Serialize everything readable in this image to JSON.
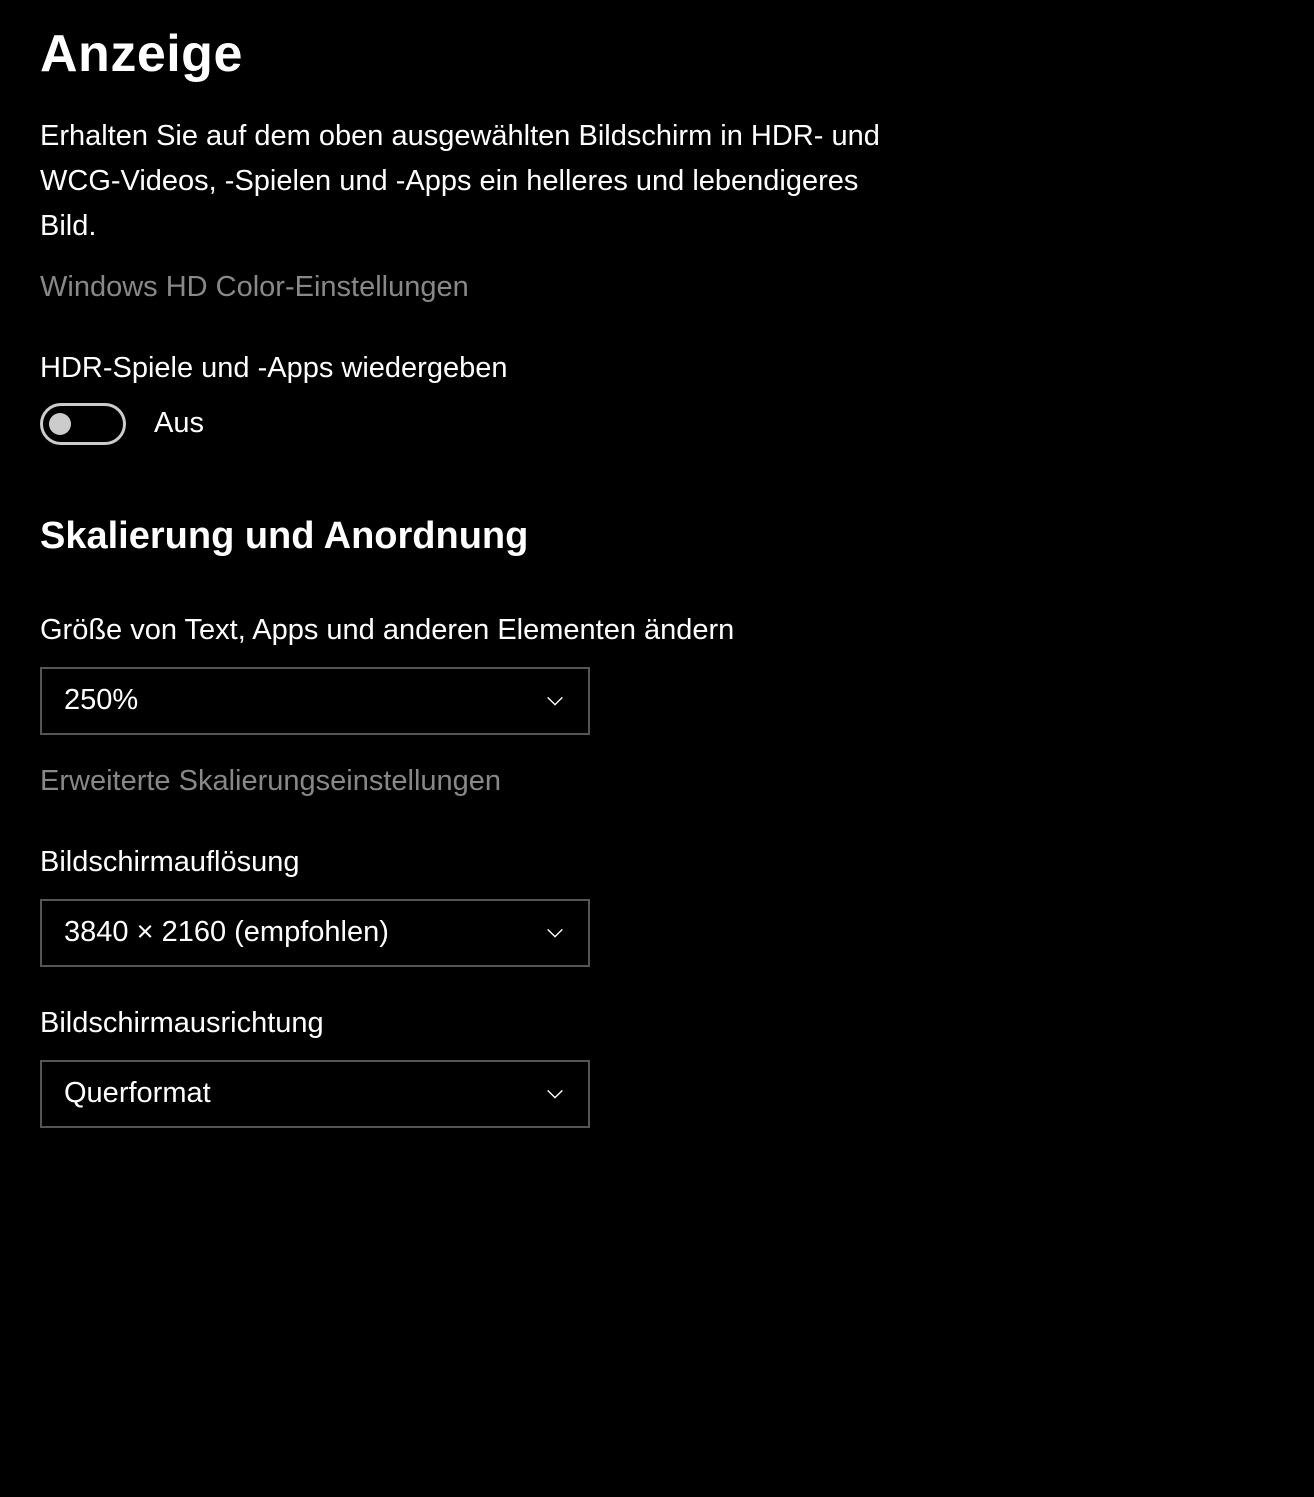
{
  "header": {
    "title": "Anzeige",
    "description": "Erhalten Sie auf dem oben ausgewählten Bildschirm in HDR- und WCG-Videos, -Spielen und -Apps ein helleres und lebendigeres Bild.",
    "hd_color_link": "Windows HD Color-Einstellungen"
  },
  "hdr": {
    "label": "HDR-Spiele und -Apps wiedergeben",
    "state": "Aus"
  },
  "scaling": {
    "section_title": "Skalierung und Anordnung",
    "text_size_label": "Größe von Text, Apps und anderen Elementen ändern",
    "text_size_value": "250%",
    "advanced_link": "Erweiterte Skalierungseinstellungen",
    "resolution_label": "Bildschirmauflösung",
    "resolution_value": "3840 × 2160 (empfohlen)",
    "orientation_label": "Bildschirmausrichtung",
    "orientation_value": "Querformat"
  }
}
